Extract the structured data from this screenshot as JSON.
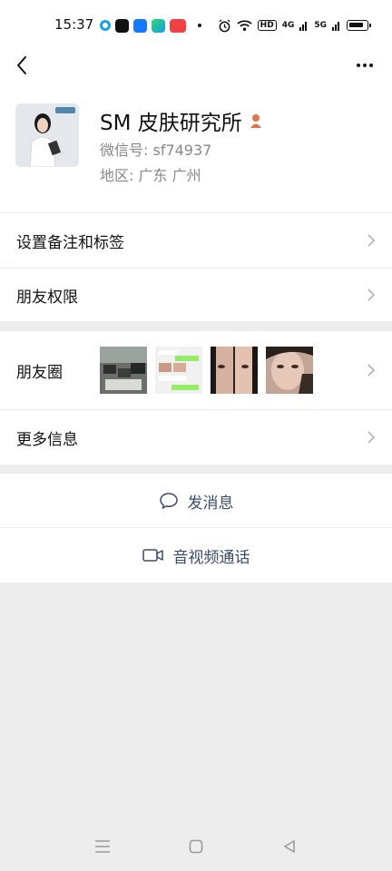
{
  "status_bar": {
    "time": "15:37",
    "network_labels": [
      "HD",
      "4G",
      "5G"
    ],
    "icons": [
      "tiktok-app-icon",
      "alipay-app-icon",
      "play-app-icon",
      "toutiao-app-icon",
      "alarm-icon",
      "wifi-icon",
      "battery-icon"
    ]
  },
  "header": {
    "back_icon": "chevron-left-icon",
    "more_icon": "more-dots-icon"
  },
  "profile": {
    "name": "SM 皮肤研究所",
    "wechat_id": "微信号:  sf74937",
    "region": "地区:  广东  广州",
    "gender_icon": "female-icon"
  },
  "menu": {
    "set_remark": "设置备注和标签",
    "friend_permissions": "朋友权限",
    "moments": "朋友圈",
    "more_info": "更多信息"
  },
  "actions": {
    "send_message": "发消息",
    "video_call": "音视频通话"
  },
  "colors": {
    "action_text": "#3b4b6a",
    "background": "#ededed",
    "card": "#ffffff"
  }
}
